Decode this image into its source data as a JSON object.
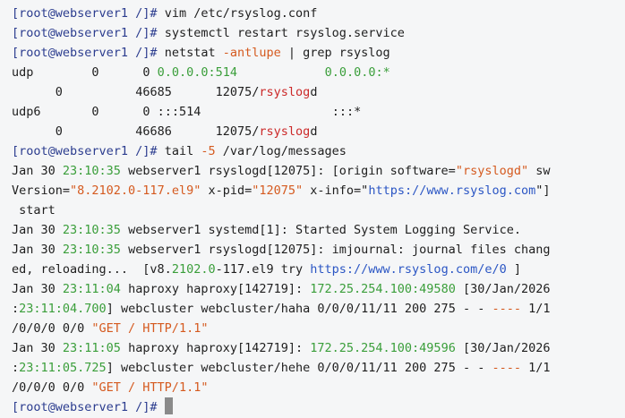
{
  "terminal": {
    "prompt": "[root@webserver1 /]# ",
    "cmd1": "vim /etc/rsyslog.conf",
    "cmd2": "systemctl restart rsyslog.service",
    "cmd3": {
      "a": "netstat ",
      "flag": "-antlupe",
      "b": " | grep rsyslog"
    },
    "netstat": [
      {
        "proto": "udp",
        "recv": "0",
        "send": "0",
        "local": "0.0.0.0:514",
        "foreign": "0.0.0.0:*"
      },
      {
        "uid": "0",
        "inode": "46685",
        "pid": "12075/",
        "prog_hi": "rsyslog",
        "prog_rest": "d"
      },
      {
        "proto": "udp6",
        "recv": "0",
        "send": "0",
        "local": ":::514",
        "foreign": ":::*"
      },
      {
        "uid": "0",
        "inode": "46686",
        "pid": "12075/",
        "prog_hi": "rsyslog",
        "prog_rest": "d"
      }
    ],
    "cmd4": {
      "a": "tail ",
      "flag": "-5",
      "b": " /var/log/messages"
    },
    "log1": {
      "date": "Jan 30 ",
      "time": "23:10:35",
      "host": " webserver1 rsyslogd[12075]: [origin software=",
      "sw": "\"rsyslogd\"",
      "sw_tail": " sw",
      "l2a": "Version=",
      "ver": "\"8.2102.0-117.el9\"",
      "l2b": " x-pid=",
      "pid": "\"12075\"",
      "l2c": " x-info=\"",
      "url": "https://www.rsyslog.com",
      "l2d": "\"]",
      "l3": " start"
    },
    "log2": {
      "date": "Jan 30 ",
      "time": "23:10:35",
      "text": " webserver1 systemd[1]: Started System Logging Service."
    },
    "log3": {
      "date": "Jan 30 ",
      "time": "23:10:35",
      "text": " webserver1 rsyslogd[12075]: imjournal: journal files chang",
      "l2a": "ed, reloading...  [v8.",
      "ver_a": "2102.0",
      "l2b": "-117.el9 try ",
      "url": "https://www.rsyslog.com/e/0",
      "l2c": " ]"
    },
    "log4": {
      "date": "Jan 30 ",
      "time": "23:11:04",
      "a": " haproxy haproxy[142719]: ",
      "ip": "172.25.254.100:49580",
      "b": " [30/Jan/2026",
      "l2a": ":",
      "t2": "23:11:04.700",
      "l2b": "] webcluster webcluster/haha 0/0/0/11/11 200 275 - - ",
      "dash": "----",
      "l2c": " 1/1",
      "l3a": "/0/0/0 0/0 ",
      "req": "\"GET / HTTP/1.1\""
    },
    "log5": {
      "date": "Jan 30 ",
      "time": "23:11:05",
      "a": " haproxy haproxy[142719]: ",
      "ip": "172.25.254.100:49596",
      "b": " [30/Jan/2026",
      "l2a": ":",
      "t2": "23:11:05.725",
      "l2b": "] webcluster webcluster/hehe 0/0/0/11/11 200 275 - - ",
      "dash": "----",
      "l2c": " 1/1",
      "l3a": "/0/0/0 0/0 ",
      "req": "\"GET / HTTP/1.1\""
    }
  }
}
